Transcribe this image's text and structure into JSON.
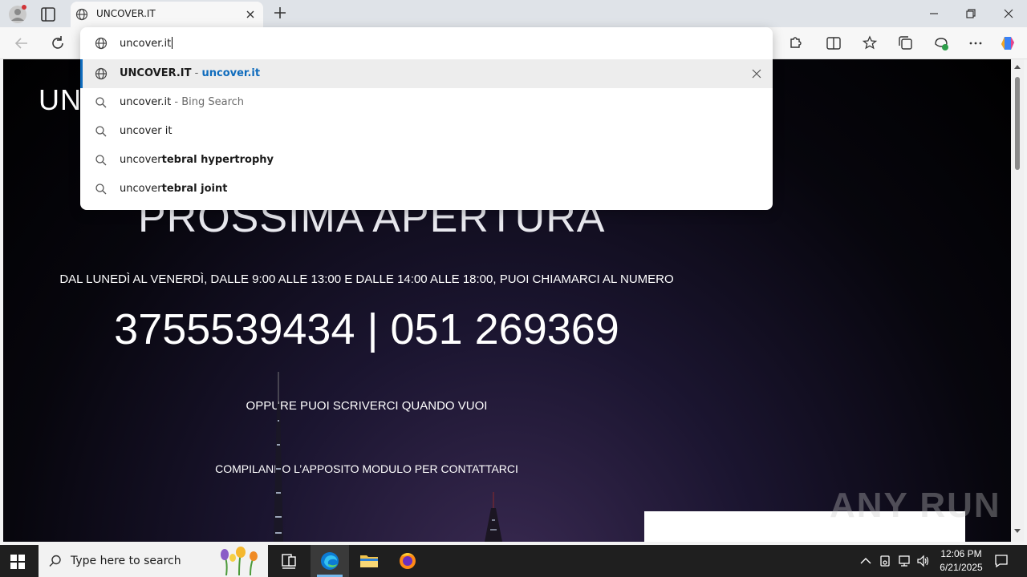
{
  "browser": {
    "tab": {
      "title": "UNCOVER.IT",
      "favicon": "globe-icon"
    },
    "address": {
      "typed_text": "uncover.it"
    },
    "suggestions": [
      {
        "icon": "globe-icon",
        "primary": "UNCOVER.IT",
        "separator": " - ",
        "url": "uncover.it",
        "selected": true
      },
      {
        "icon": "search-icon",
        "normal": "uncover.it",
        "separator": " - ",
        "source": "Bing Search"
      },
      {
        "icon": "search-icon",
        "normal": "uncover it"
      },
      {
        "icon": "search-icon",
        "normal": "uncover",
        "bold": "tebral hypertrophy"
      },
      {
        "icon": "search-icon",
        "normal": "uncover",
        "bold": "tebral joint"
      }
    ],
    "accent_color": "#0f6cbd"
  },
  "page": {
    "logo_text": "UN",
    "headline": "PROSSIMA APERTURA",
    "hours_text": "DAL LUNEDÌ AL VENERDÌ, DALLE 9:00 ALLE 13:00 E DALLE 14:00 ALLE 18:00, PUOI CHIAMARCI AL NUMERO",
    "phones": "3755539434 | 051 269369",
    "write_text": "OPPURE PUOI SCRIVERCI QUANDO VUOI",
    "form_text": "COMPILANDO L’APPOSITO MODULO PER CONTATTARCI",
    "watermark": "ANY RUN"
  },
  "taskbar": {
    "search_placeholder": "Type here to search",
    "time": "12:06 PM",
    "date": "6/21/2025"
  }
}
